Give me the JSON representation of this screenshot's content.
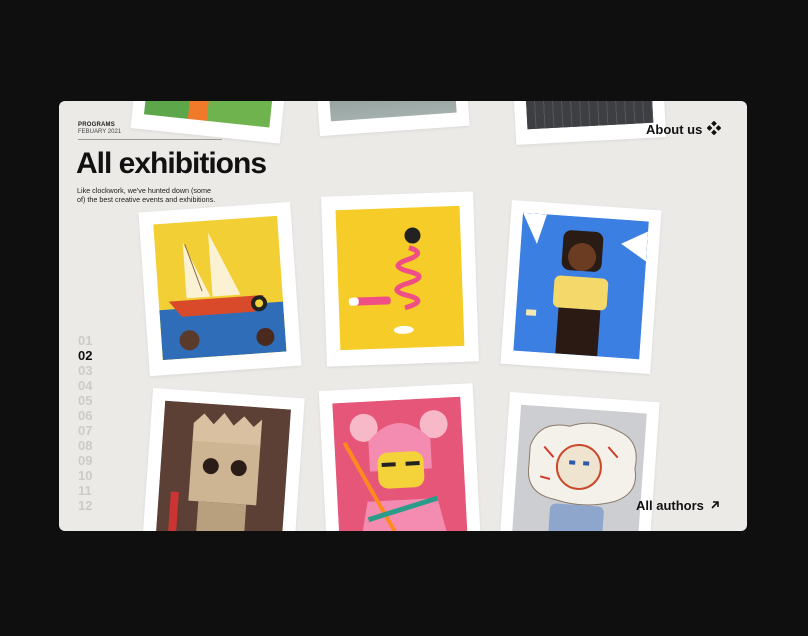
{
  "header": {
    "section": "PROGRAMS",
    "date": "FEBUARY 2021",
    "title": "All exhibitions",
    "description": "Like clockwork, we've hunted down (some of) the best creative events and exhibitions."
  },
  "nav": {
    "about_label": "About us",
    "about_icon": "diamond-cluster-icon",
    "authors_label": "All authors",
    "authors_icon": "arrow-up-right-icon"
  },
  "pagination": {
    "items": [
      "01",
      "02",
      "03",
      "04",
      "05",
      "06",
      "07",
      "08",
      "09",
      "10",
      "11",
      "12"
    ],
    "active": "02"
  },
  "colors": {
    "background": "#0f0f10",
    "card": "#eceae7",
    "accent_yellow": "#f2d33a",
    "accent_pink": "#e8577d"
  }
}
